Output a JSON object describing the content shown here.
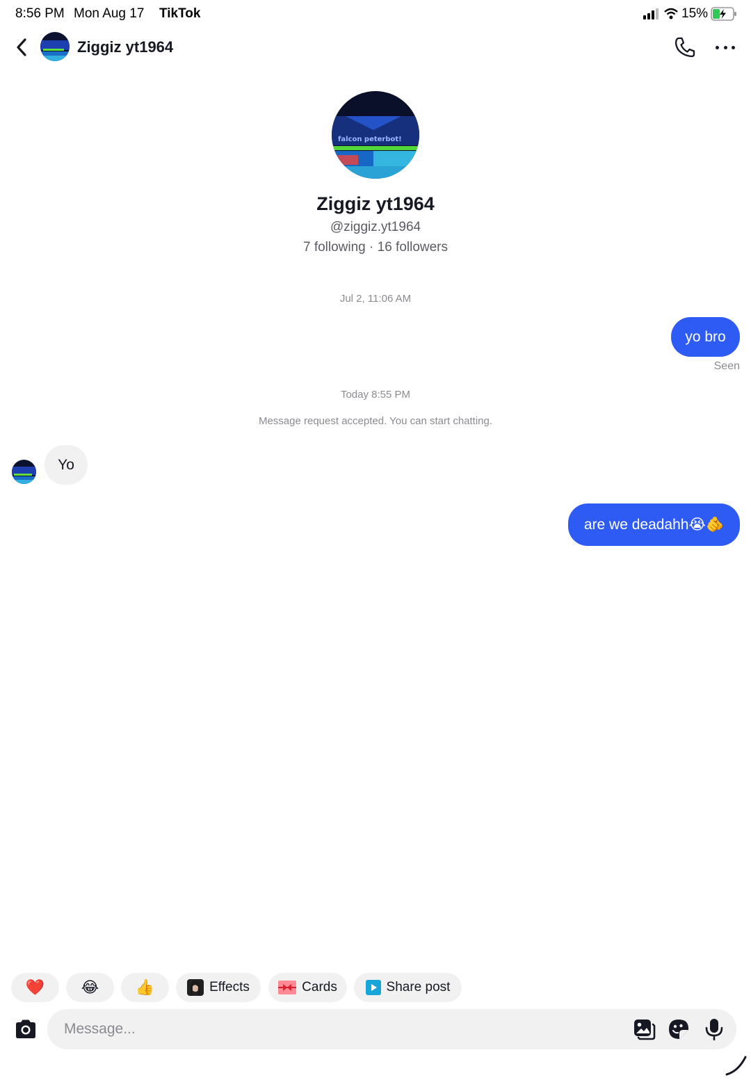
{
  "status_bar": {
    "time": "8:56 PM",
    "date": "Mon Aug 17",
    "app": "TikTok",
    "battery_percent": "15%",
    "icons": [
      "signal-icon",
      "wifi-icon",
      "battery-charging-icon"
    ]
  },
  "header": {
    "title": "Ziggiz yt1964",
    "icons": [
      "back-chevron-icon",
      "avatar",
      "phone-icon",
      "more-dots-icon"
    ]
  },
  "profile": {
    "avatar_text": "falcon peterbot!",
    "name": "Ziggiz yt1964",
    "handle": "@ziggiz.yt1964",
    "stats": "7 following · 16 followers"
  },
  "chat": {
    "timestamp_1": "Jul 2, 11:06 AM",
    "outgoing_1": "yo bro",
    "seen_label": "Seen",
    "timestamp_2": "Today 8:55 PM",
    "system_note": "Message request accepted. You can start chatting.",
    "incoming_1": "Yo",
    "outgoing_2": "are we deadahh😭🫵"
  },
  "quick_actions": {
    "heart": "❤️",
    "laugh": "😂",
    "thumbs_up": "👍",
    "effects_label": "Effects",
    "cards_label": "Cards",
    "share_label": "Share post"
  },
  "composer": {
    "placeholder": "Message...",
    "value": ""
  },
  "colors": {
    "outgoing_bubble": "#2f5bf5",
    "incoming_bubble": "#f1f1f2",
    "chip_background": "#f1f1f2",
    "secondary_text": "#8a8b91"
  }
}
